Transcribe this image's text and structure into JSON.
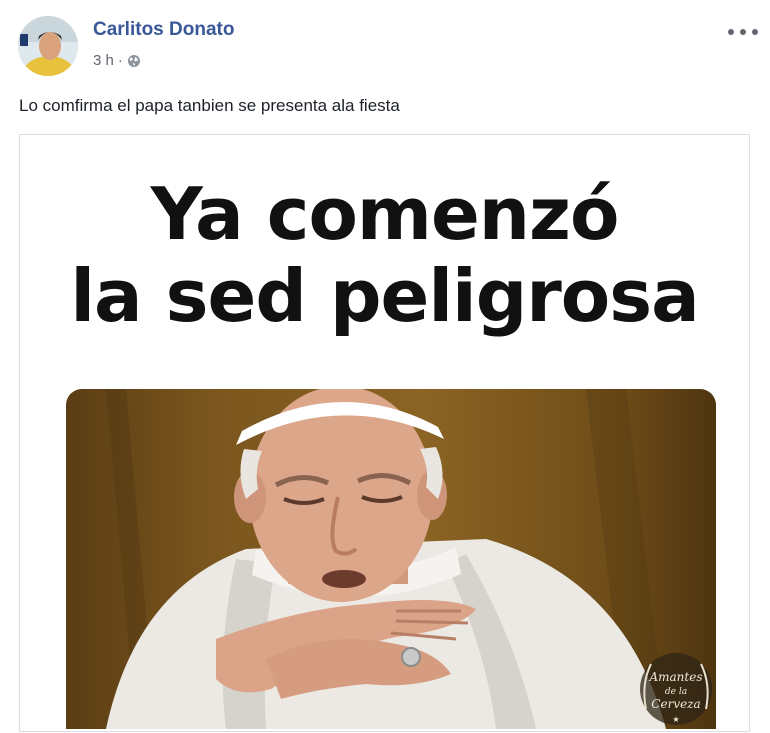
{
  "post": {
    "author": "Carlitos Donato",
    "time": "3 h",
    "separator": "·",
    "privacy_icon": "globe-icon",
    "menu_icon": "more-dots-icon",
    "caption": "Lo comfirma el papa tanbien se presenta ala fiesta"
  },
  "meme": {
    "title_line1": "Ya comenzó",
    "title_line2": "la sed peligrosa",
    "watermark_line1": "Amantes",
    "watermark_line2": "de la",
    "watermark_line3": "Cerveza"
  },
  "colors": {
    "author_link": "#385898",
    "meta_text": "#616770",
    "photo_background": "#7a561e"
  }
}
